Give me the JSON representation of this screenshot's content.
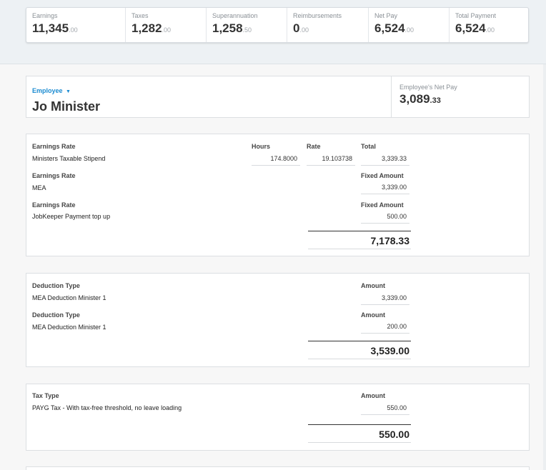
{
  "summary": [
    {
      "label": "Earnings",
      "whole": "11,345",
      "cents": ".00"
    },
    {
      "label": "Taxes",
      "whole": "1,282",
      "cents": ".00"
    },
    {
      "label": "Superannuation",
      "whole": "1,258",
      "cents": ".50"
    },
    {
      "label": "Reimbursements",
      "whole": "0",
      "cents": ".00"
    },
    {
      "label": "Net Pay",
      "whole": "6,524",
      "cents": ".00"
    },
    {
      "label": "Total Payment",
      "whole": "6,524",
      "cents": ".00"
    }
  ],
  "employee": {
    "label": "Employee",
    "name": "Jo Minister",
    "net_pay_label": "Employee's Net Pay",
    "net_pay_whole": "3,089",
    "net_pay_cents": ".33"
  },
  "earnings": {
    "rows": [
      {
        "type_label": "Earnings Rate",
        "name": "Ministers Taxable Stipend",
        "hours_label": "Hours",
        "hours": "174.8000",
        "rate_label": "Rate",
        "rate": "19.103738",
        "amount_label": "Total",
        "amount": "3,339.33"
      },
      {
        "type_label": "Earnings Rate",
        "name": "MEA",
        "amount_label": "Fixed Amount",
        "amount": "3,339.00"
      },
      {
        "type_label": "Earnings Rate",
        "name": "JobKeeper Payment top up",
        "amount_label": "Fixed Amount",
        "amount": "500.00"
      }
    ],
    "total": "7,178.33"
  },
  "deductions": {
    "rows": [
      {
        "type_label": "Deduction Type",
        "name": "MEA Deduction Minister 1",
        "amount_label": "Amount",
        "amount": "3,339.00"
      },
      {
        "type_label": "Deduction Type",
        "name": "MEA Deduction Minister 1",
        "amount_label": "Amount",
        "amount": "200.00"
      }
    ],
    "total": "3,539.00"
  },
  "taxes": {
    "rows": [
      {
        "type_label": "Tax Type",
        "name": "PAYG Tax - With tax-free threshold, no leave loading",
        "amount_label": "Amount",
        "amount": "550.00"
      }
    ],
    "total": "550.00"
  },
  "colors": {
    "accent": "#1b8bd1",
    "band": "#edf1f4"
  }
}
